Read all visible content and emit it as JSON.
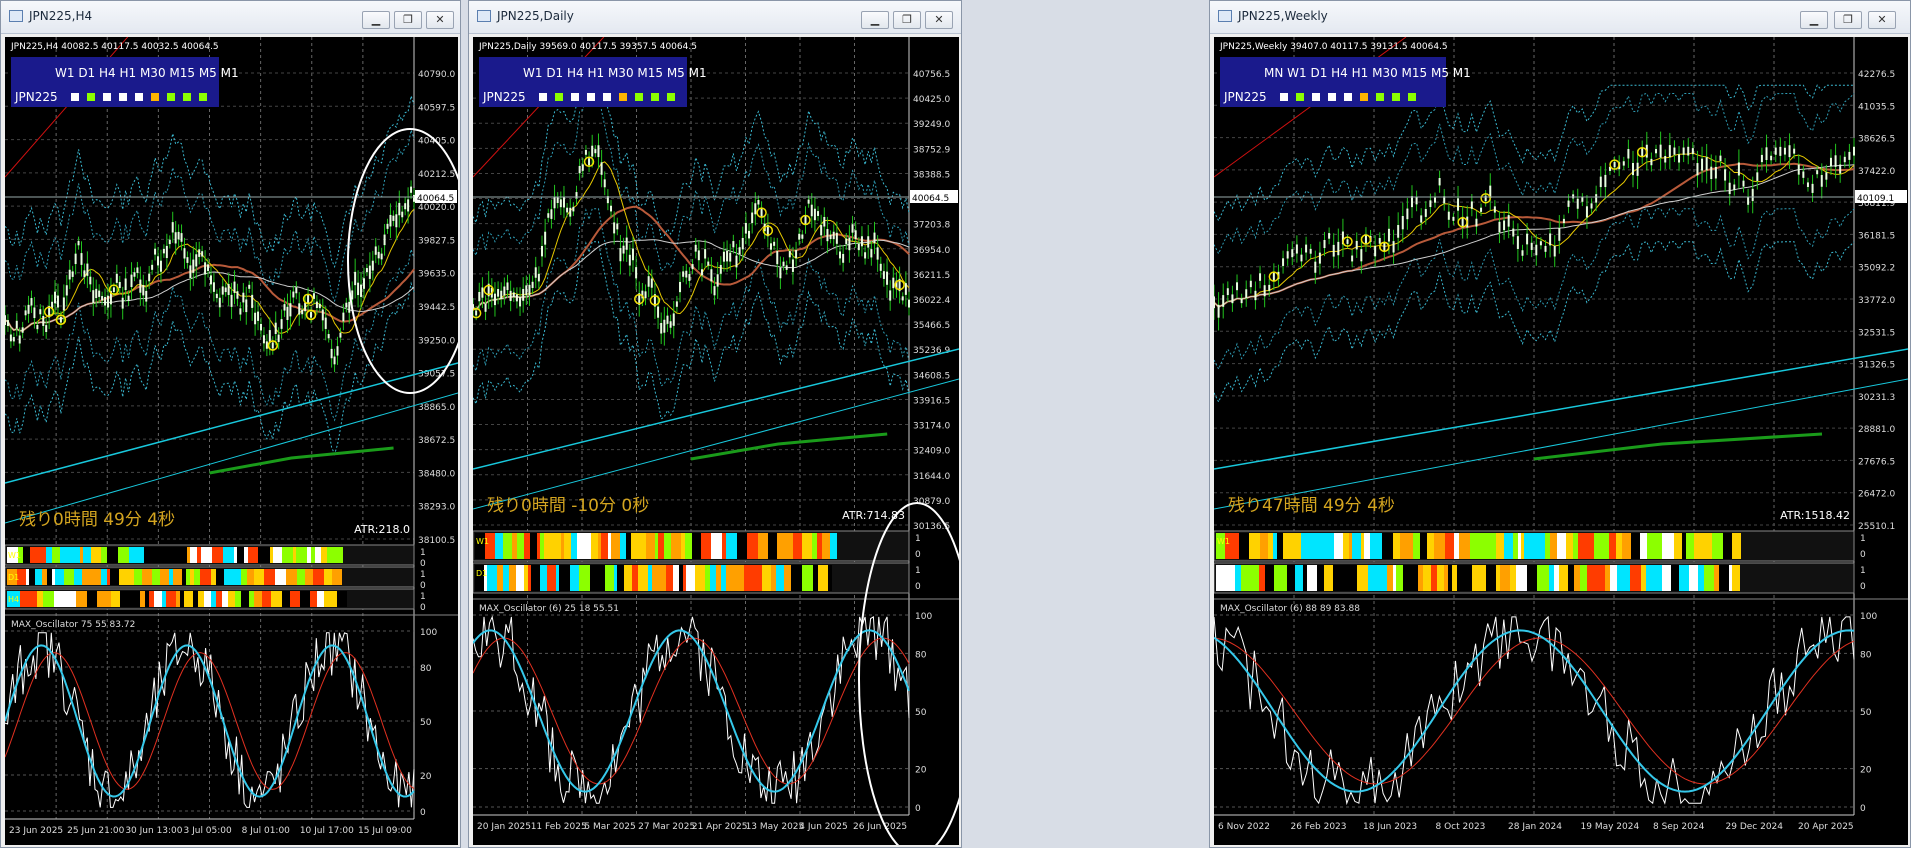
{
  "windows": [
    {
      "title": "JPN225,H4",
      "header": "JPN225,H4  40082.5  40117.5  40032.5  40064.5",
      "tf_row": "W1 D1 H4 H1 M30 M15 M5 M1",
      "symbol": "JPN225",
      "countdown": "残り0時間 49分 4秒",
      "atr": "ATR:218.0",
      "price_current": "40064.5",
      "price_scale": [
        "40790.0",
        "40597.5",
        "40405.0",
        "40212.5",
        "40020.0",
        "39827.5",
        "39635.0",
        "39442.5",
        "39250.0",
        "39057.5",
        "38865.0",
        "38672.5",
        "38480.0",
        "38293.0",
        "38100.5"
      ],
      "bar_labels": [
        "W1",
        "D1",
        "H4"
      ],
      "bar_scale": [
        "1",
        "0",
        "1",
        "0",
        "1",
        "0"
      ],
      "osc_label": "MAX_Oscillator 75 55 83.72",
      "osc_scale": [
        "100",
        "80",
        "50",
        "20",
        "0"
      ],
      "dates": [
        "23 Jun 2025",
        "25 Jun 21:00",
        "30 Jun 13:00",
        "3 Jul 05:00",
        "8 Jul 01:00",
        "10 Jul 17:00",
        "15 Jul 09:00"
      ]
    },
    {
      "title": "JPN225,Daily",
      "header": "JPN225,Daily  39569.0  40117.5  39357.5  40064.5",
      "tf_row": "W1 D1 H4 H1 M30 M15 M5 M1",
      "symbol": "JPN225",
      "countdown": "残り0時間 -10分 0秒",
      "atr": "ATR:714.83",
      "price_current": "40064.5",
      "price_scale": [
        "40756.5",
        "40425.0",
        "39249.0",
        "38752.9",
        "38388.5",
        "37612.3",
        "37203.8",
        "36954.0",
        "36211.5",
        "36022.4",
        "35466.5",
        "35236.9",
        "34608.5",
        "33916.5",
        "33174.0",
        "32409.0",
        "31644.0",
        "30879.0",
        "30136.5"
      ],
      "bar_labels": [
        "W1",
        "D1"
      ],
      "bar_scale": [
        "1",
        "0",
        "1",
        "0"
      ],
      "osc_label": "MAX_Oscillator (6) 25 18 55.51",
      "osc_scale": [
        "100",
        "80",
        "50",
        "20",
        "0"
      ],
      "dates": [
        "20 Jan 2025",
        "11 Feb 2025",
        "5 Mar 2025",
        "27 Mar 2025",
        "21 Apr 2025",
        "13 May 2025",
        "4 Jun 2025",
        "26 Jun 2025"
      ]
    },
    {
      "title": "JPN225,Weekly",
      "header": "JPN225,Weekly  39407.0  40117.5  39131.5  40064.5",
      "tf_row": "MN W1 D1 H4 H1 M30 M15 M5 M1",
      "symbol": "JPN225",
      "countdown": "残り47時間 49分 4秒",
      "atr": "ATR:1518.42",
      "price_current": "40109.1",
      "price_scale": [
        "42276.5",
        "41035.5",
        "38626.5",
        "37422.0",
        "36811.9",
        "36181.5",
        "35092.2",
        "33772.0",
        "32531.5",
        "31326.5",
        "30231.3",
        "28881.0",
        "27676.5",
        "26472.0",
        "25510.1"
      ],
      "bar_labels": [
        "W1",
        ""
      ],
      "bar_scale": [
        "1",
        "0",
        "1",
        "0"
      ],
      "osc_label": "MAX_Oscillator (6) 88 89 83.88",
      "osc_scale": [
        "100",
        "80",
        "50",
        "20",
        "0"
      ],
      "dates": [
        "6 Nov 2022",
        "26 Feb 2023",
        "18 Jun 2023",
        "8 Oct 2023",
        "28 Jan 2024",
        "19 May 2024",
        "8 Sep 2024",
        "29 Dec 2024",
        "20 Apr 2025"
      ]
    }
  ],
  "colors": {
    "bg": "#000000",
    "candle": "#22c51e",
    "fib": "#00c8ff",
    "ma_brown": "#b85a3a",
    "ma_yellow": "#e6c800",
    "osc_cyan": "#35c8ea",
    "osc_red": "#e03020",
    "osc_white": "#ffffff",
    "countdown": "#d4a520",
    "panel": "#1a1a8c"
  },
  "window_controls": [
    "minimize-icon",
    "maximize-icon",
    "close-icon"
  ]
}
